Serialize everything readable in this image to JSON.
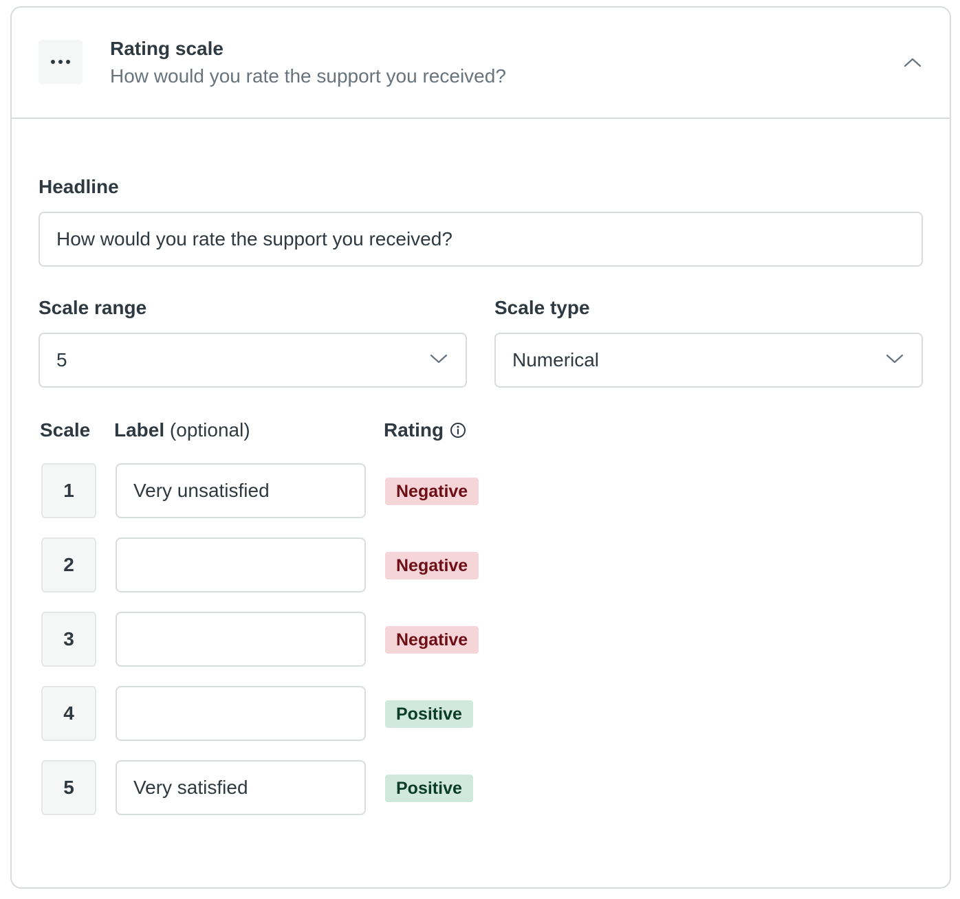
{
  "header": {
    "title": "Rating scale",
    "subtitle": "How would you rate the support you received?",
    "drag_icon": "more-horizontal-icon",
    "collapse_icon": "chevron-up-icon"
  },
  "headline": {
    "label": "Headline",
    "value": "How would you rate the support you received?"
  },
  "scale_range": {
    "label": "Scale range",
    "value": "5",
    "icon": "chevron-down-icon"
  },
  "scale_type": {
    "label": "Scale type",
    "value": "Numerical",
    "icon": "chevron-down-icon"
  },
  "columns": {
    "scale": "Scale",
    "label": "Label",
    "label_hint": "(optional)",
    "rating": "Rating",
    "rating_icon": "info-icon"
  },
  "rows": [
    {
      "scale": "1",
      "label": "Very unsatisfied",
      "rating": "Negative",
      "sentiment": "negative"
    },
    {
      "scale": "2",
      "label": "",
      "rating": "Negative",
      "sentiment": "negative"
    },
    {
      "scale": "3",
      "label": "",
      "rating": "Negative",
      "sentiment": "negative"
    },
    {
      "scale": "4",
      "label": "",
      "rating": "Positive",
      "sentiment": "positive"
    },
    {
      "scale": "5",
      "label": "Very satisfied",
      "rating": "Positive",
      "sentiment": "positive"
    }
  ],
  "colors": {
    "negative_bg": "#f5d5d8",
    "negative_text": "#6e0e17",
    "positive_bg": "#d1e8df",
    "positive_text": "#0b3b29",
    "border": "#d8dcde"
  }
}
